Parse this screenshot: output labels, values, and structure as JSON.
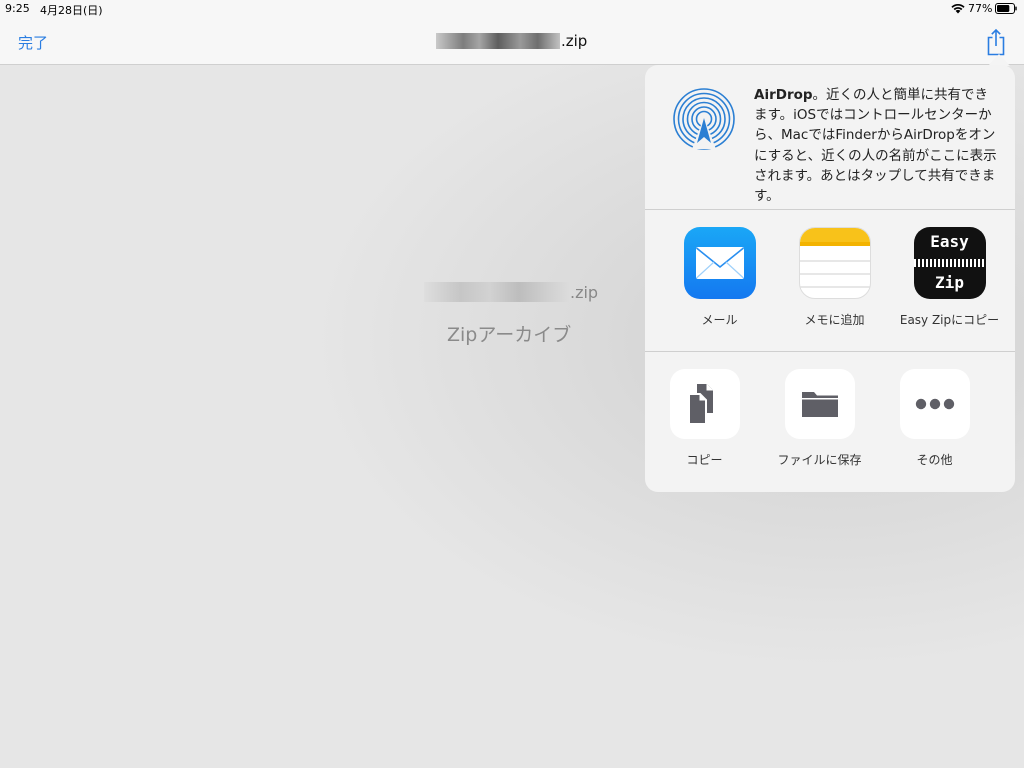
{
  "status_bar": {
    "time": "9:25",
    "date": "4月28日(日)",
    "battery_percent": "77%",
    "battery_level": 0.77
  },
  "nav": {
    "done_label": "完了",
    "title_suffix": ".zip"
  },
  "file": {
    "name_suffix": ".zip",
    "type_label": "Zipアーカイブ"
  },
  "share_sheet": {
    "airdrop": {
      "title": "AirDrop",
      "description": "。近くの人と簡単に共有できます。iOSではコントロールセンターから、MacではFinderからAirDropをオンにすると、近くの人の名前がここに表示されます。あとはタップして共有できます。"
    },
    "apps": [
      {
        "label": "メール",
        "icon": "mail-icon"
      },
      {
        "label": "メモに追加",
        "icon": "notes-icon"
      },
      {
        "label": "Easy Zipにコピー",
        "icon": "easy-zip-icon",
        "icon_text_top": "Easy",
        "icon_text_bottom": "Zip"
      }
    ],
    "actions": [
      {
        "label": "コピー",
        "icon": "copy-icon"
      },
      {
        "label": "ファイルに保存",
        "icon": "folder-icon"
      },
      {
        "label": "その他",
        "icon": "more-icon"
      }
    ]
  },
  "colors": {
    "accent": "#2a7de1",
    "airdrop_blue": "#2b7fd3",
    "action_icon_gray": "#5f5f66"
  }
}
